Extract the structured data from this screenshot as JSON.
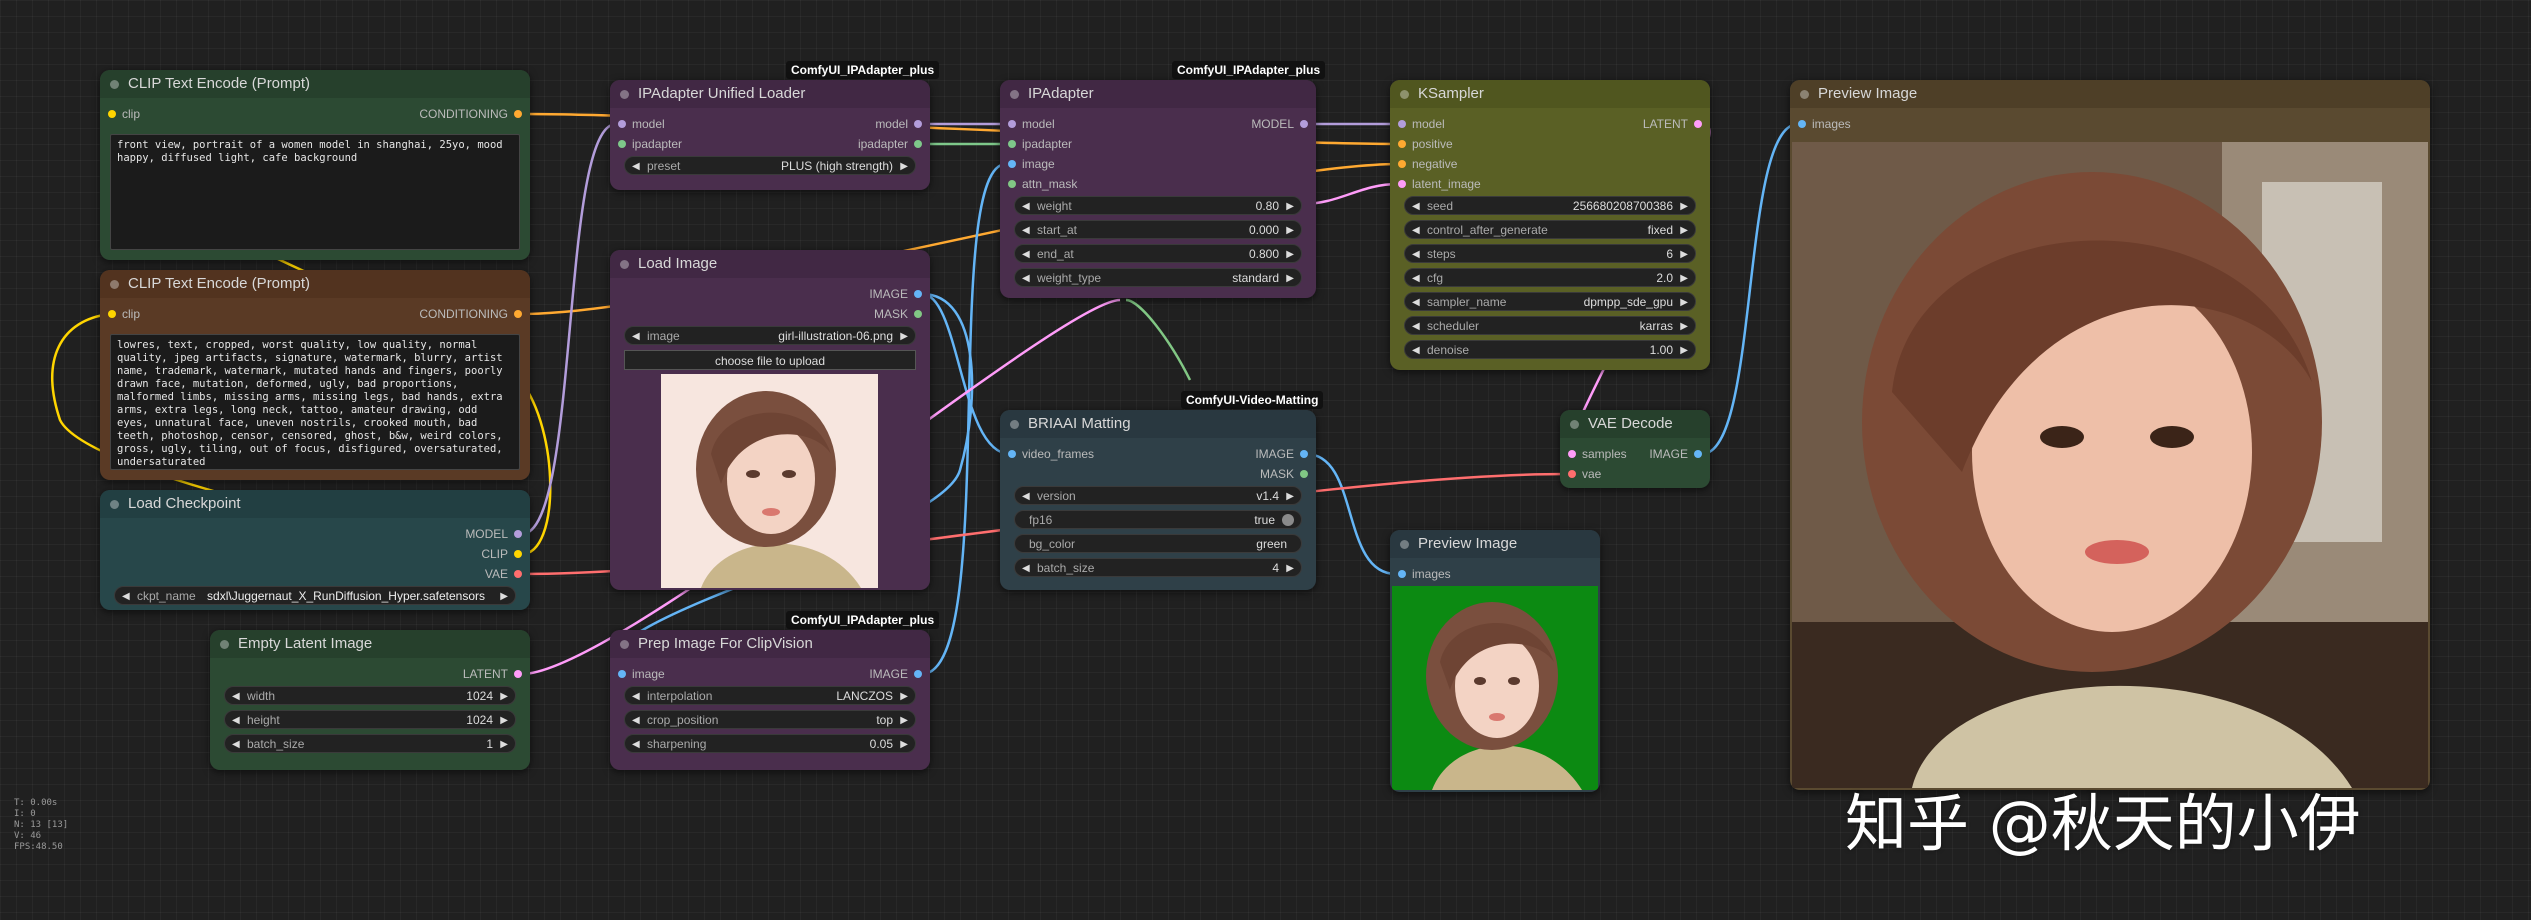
{
  "colors": {
    "canvas_bg": "#202020",
    "green_node": "#2c4a33",
    "brown_node": "#5a3a25",
    "teal_node": "#27474a",
    "purple_node": "#4a2e4d",
    "olive_node": "#5a6025",
    "slate_node": "#2f4048",
    "link_conditioning": "#ffa931",
    "link_clip": "#ffd500",
    "link_model": "#b39ddb",
    "link_image": "#64b5f6",
    "link_latent": "#ff9cf9",
    "link_vae": "#ff6e6e",
    "link_mask": "#81c784",
    "link_ipadapter": "#7ec88a"
  },
  "nodes": {
    "clip_pos": {
      "title": "CLIP Text Encode (Prompt)",
      "in_clip": "clip",
      "out_conditioning": "CONDITIONING",
      "text": "front view, portrait of a women model in shanghai, 25yo, mood happy, diffused light, cafe background"
    },
    "clip_neg": {
      "title": "CLIP Text Encode (Prompt)",
      "in_clip": "clip",
      "out_conditioning": "CONDITIONING",
      "text": "lowres, text, cropped, worst quality, low quality, normal quality, jpeg artifacts, signature, watermark, blurry, artist name, trademark, watermark, mutated hands and fingers, poorly drawn face, mutation, deformed, ugly, bad proportions, malformed limbs, missing arms, missing legs, bad hands, extra arms, extra legs, long neck, tattoo, amateur drawing, odd eyes, unnatural face, uneven nostrils, crooked mouth, bad teeth, photoshop, censor, censored, ghost, b&w, weird colors, gross, ugly, tiling, out of focus, disfigured, oversaturated, undersaturated"
    },
    "checkpoint": {
      "title": "Load Checkpoint",
      "out_model": "MODEL",
      "out_clip": "CLIP",
      "out_vae": "VAE",
      "ckpt_label": "ckpt_name",
      "ckpt_value": "sdxl\\Juggernaut_X_RunDiffusion_Hyper.safetensors"
    },
    "latent": {
      "title": "Empty Latent Image",
      "out_latent": "LATENT",
      "w_label": "width",
      "w_value": "1024",
      "h_label": "height",
      "h_value": "1024",
      "b_label": "batch_size",
      "b_value": "1"
    },
    "ipa_loader": {
      "badge": "ComfyUI_IPAdapter_plus",
      "title": "IPAdapter Unified Loader",
      "in_model": "model",
      "in_ipadapter": "ipadapter",
      "out_model": "model",
      "out_ipadapter": "ipadapter",
      "preset_label": "preset",
      "preset_value": "PLUS (high strength)"
    },
    "load_image": {
      "title": "Load Image",
      "out_image": "IMAGE",
      "out_mask": "MASK",
      "image_label": "image",
      "image_value": "girl-illustration-06.png",
      "upload_label": "choose file to upload"
    },
    "prep": {
      "badge": "ComfyUI_IPAdapter_plus",
      "title": "Prep Image For ClipVision",
      "in_image": "image",
      "out_image": "IMAGE",
      "interp_label": "interpolation",
      "interp_value": "LANCZOS",
      "crop_label": "crop_position",
      "crop_value": "top",
      "sharp_label": "sharpening",
      "sharp_value": "0.05"
    },
    "ipadapter": {
      "badge": "ComfyUI_IPAdapter_plus",
      "title": "IPAdapter",
      "in_model": "model",
      "in_ipadapter": "ipadapter",
      "in_image": "image",
      "in_attn": "attn_mask",
      "out_model": "MODEL",
      "weight_label": "weight",
      "weight_value": "0.80",
      "start_label": "start_at",
      "start_value": "0.000",
      "end_label": "end_at",
      "end_value": "0.800",
      "wtype_label": "weight_type",
      "wtype_value": "standard"
    },
    "briaai": {
      "badge": "ComfyUI-Video-Matting",
      "title": "BRIAAI Matting",
      "in_frames": "video_frames",
      "out_image": "IMAGE",
      "out_mask": "MASK",
      "version_label": "version",
      "version_value": "v1.4",
      "fp16_label": "fp16",
      "fp16_value": "true",
      "bg_label": "bg_color",
      "bg_value": "green",
      "batch_label": "batch_size",
      "batch_value": "4"
    },
    "ksampler": {
      "title": "KSampler",
      "in_model": "model",
      "in_positive": "positive",
      "in_negative": "negative",
      "in_latent": "latent_image",
      "out_latent": "LATENT",
      "seed_label": "seed",
      "seed_value": "256680208700386",
      "cag_label": "control_after_generate",
      "cag_value": "fixed",
      "steps_label": "steps",
      "steps_value": "6",
      "cfg_label": "cfg",
      "cfg_value": "2.0",
      "sampler_label": "sampler_name",
      "sampler_value": "dpmpp_sde_gpu",
      "sched_label": "scheduler",
      "sched_value": "karras",
      "denoise_label": "denoise",
      "denoise_value": "1.00"
    },
    "vae_decode": {
      "title": "VAE Decode",
      "in_samples": "samples",
      "in_vae": "vae",
      "out_image": "IMAGE"
    },
    "preview_small": {
      "title": "Preview Image",
      "in_images": "images"
    },
    "preview_big": {
      "title": "Preview Image",
      "in_images": "images"
    }
  },
  "stats": [
    "T: 0.00s",
    "I: 0",
    "N: 13 [13]",
    "V: 46",
    "FPS:48.50"
  ],
  "watermark": "知乎 @秋天的小伊"
}
